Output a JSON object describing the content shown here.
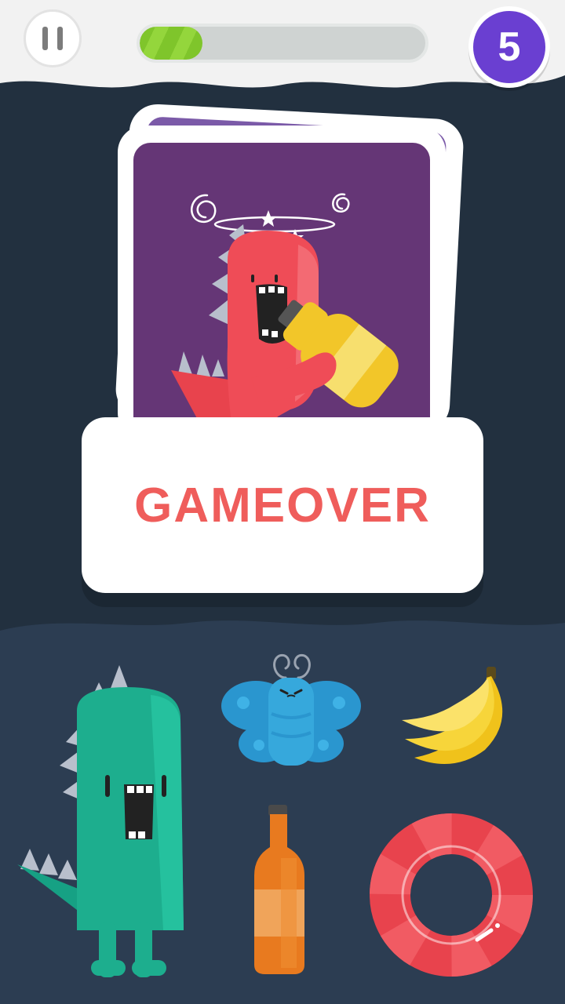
{
  "header": {
    "pause_icon": "pause-icon",
    "progress": 0.22,
    "level": "5"
  },
  "card": {
    "image": "dizzy-red-monster-drinking-bottle"
  },
  "result": {
    "message": "GAMEOVER"
  },
  "items": [
    {
      "name": "green-monster",
      "icon": "green-monster-icon"
    },
    {
      "name": "blue-butterfly",
      "icon": "butterfly-icon"
    },
    {
      "name": "banana",
      "icon": "banana-icon"
    },
    {
      "name": "orange-bottle",
      "icon": "bottle-icon"
    },
    {
      "name": "red-swim-ring",
      "icon": "swim-ring-icon"
    }
  ],
  "colors": {
    "background": "#22303f",
    "lower_background": "#2c3d52",
    "accent": "#ef5d5b",
    "level_badge": "#6a3fd1",
    "progress": "#7fc52b"
  }
}
